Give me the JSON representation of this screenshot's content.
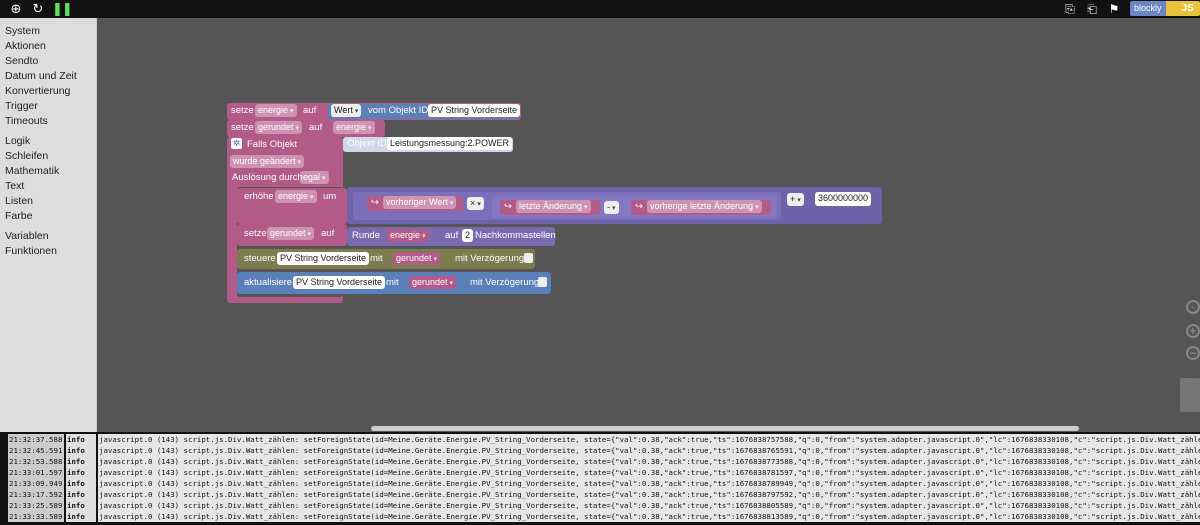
{
  "topbar": {
    "icons": [
      "target-icon",
      "refresh-icon",
      "pause-icon"
    ],
    "mode_blockly": "blockly",
    "mode_js": "JS"
  },
  "toolbox": {
    "group1": [
      "System",
      "Aktionen",
      "Sendto",
      "Datum und Zeit",
      "Konvertierung",
      "Trigger",
      "Timeouts"
    ],
    "group2": [
      "Logik",
      "Schleifen",
      "Mathematik",
      "Text",
      "Listen",
      "Farbe"
    ],
    "group3": [
      "Variablen",
      "Funktionen"
    ]
  },
  "blocks": {
    "set1": {
      "setze": "setze",
      "var": "energie",
      "auf": "auf",
      "wert": "Wert",
      "vom": "vom Objekt ID",
      "obj": "PV String Vorderseite"
    },
    "set2": {
      "setze": "setze",
      "var": "gerundet",
      "auf": "auf",
      "val": "energie"
    },
    "trigger": {
      "falls": "Falls Objekt",
      "objid_label": "Objekt ID",
      "objid": "Leistungsmessung:2.POWER",
      "changed": "wurde geändert",
      "ausloesung": "Auslösung durch",
      "egal": "egal"
    },
    "increase": {
      "erhoehe": "erhöhe",
      "var": "energie",
      "um": "um",
      "prev": "vorheriger Wert",
      "times": "×",
      "last": "letzte Änderung",
      "minus": "-",
      "prevlast": "vorherige letzte Änderung",
      "plus": "+",
      "num": "3600000000"
    },
    "set3": {
      "setze": "setze",
      "var": "gerundet",
      "auf": "auf",
      "runde": "Runde",
      "val": "energie",
      "auf2": "auf",
      "digits": "2",
      "nach": "Nachkommastellen"
    },
    "control": {
      "steuere": "steuere",
      "obj": "PV String Vorderseite",
      "mit": "mit",
      "val": "gerundet",
      "delay": "mit Verzögerung"
    },
    "update": {
      "aktualisiere": "aktualisiere",
      "obj": "PV String Vorderseite",
      "mit": "mit",
      "val": "gerundet",
      "delay": "mit Verzögerung"
    }
  },
  "log": [
    {
      "ts": "21:32:37.588",
      "lvl": "info",
      "msg": "javascript.0 (143) script.js.Div.Watt_zählen: setForeignState(id=Meine.Geräte.Energie.PV_String_Vorderseite, state={\"val\":0.38,\"ack\":true,\"ts\":1676838757588,\"q\":0,\"from\":\"system.adapter.javascript.0\",\"lc\":1676838330108,\"c\":\"script.js.Div.Watt_zählen\"})"
    },
    {
      "ts": "21:32:45.591",
      "lvl": "info",
      "msg": "javascript.0 (143) script.js.Div.Watt_zählen: setForeignState(id=Meine.Geräte.Energie.PV_String_Vorderseite, state={\"val\":0.38,\"ack\":true,\"ts\":1676838765591,\"q\":0,\"from\":\"system.adapter.javascript.0\",\"lc\":1676838330108,\"c\":\"script.js.Div.Watt_zählen\"})"
    },
    {
      "ts": "21:32:53.588",
      "lvl": "info",
      "msg": "javascript.0 (143) script.js.Div.Watt_zählen: setForeignState(id=Meine.Geräte.Energie.PV_String_Vorderseite, state={\"val\":0.38,\"ack\":true,\"ts\":1676838773588,\"q\":0,\"from\":\"system.adapter.javascript.0\",\"lc\":1676838330108,\"c\":\"script.js.Div.Watt_zählen\"})"
    },
    {
      "ts": "21:33:01.597",
      "lvl": "info",
      "msg": "javascript.0 (143) script.js.Div.Watt_zählen: setForeignState(id=Meine.Geräte.Energie.PV_String_Vorderseite, state={\"val\":0.38,\"ack\":true,\"ts\":1676838781597,\"q\":0,\"from\":\"system.adapter.javascript.0\",\"lc\":1676838330108,\"c\":\"script.js.Div.Watt_zählen\"})"
    },
    {
      "ts": "21:33:09.949",
      "lvl": "info",
      "msg": "javascript.0 (143) script.js.Div.Watt_zählen: setForeignState(id=Meine.Geräte.Energie.PV_String_Vorderseite, state={\"val\":0.38,\"ack\":true,\"ts\":1676838789949,\"q\":0,\"from\":\"system.adapter.javascript.0\",\"lc\":1676838330108,\"c\":\"script.js.Div.Watt_zählen\"})"
    },
    {
      "ts": "21:33:17.592",
      "lvl": "info",
      "msg": "javascript.0 (143) script.js.Div.Watt_zählen: setForeignState(id=Meine.Geräte.Energie.PV_String_Vorderseite, state={\"val\":0.38,\"ack\":true,\"ts\":1676838797592,\"q\":0,\"from\":\"system.adapter.javascript.0\",\"lc\":1676838330108,\"c\":\"script.js.Div.Watt_zählen\"})"
    },
    {
      "ts": "21:33:25.589",
      "lvl": "info",
      "msg": "javascript.0 (143) script.js.Div.Watt_zählen: setForeignState(id=Meine.Geräte.Energie.PV_String_Vorderseite, state={\"val\":0.38,\"ack\":true,\"ts\":1676838805589,\"q\":0,\"from\":\"system.adapter.javascript.0\",\"lc\":1676838330108,\"c\":\"script.js.Div.Watt_zählen\"})"
    },
    {
      "ts": "21:33:33.589",
      "lvl": "info",
      "msg": "javascript.0 (143) script.js.Div.Watt_zählen: setForeignState(id=Meine.Geräte.Energie.PV_String_Vorderseite, state={\"val\":0.38,\"ack\":true,\"ts\":1676838813589,\"q\":0,\"from\":\"system.adapter.javascript.0\",\"lc\":1676838330108,\"c\":\"script.js.Div.Watt_zählen\"})"
    }
  ]
}
